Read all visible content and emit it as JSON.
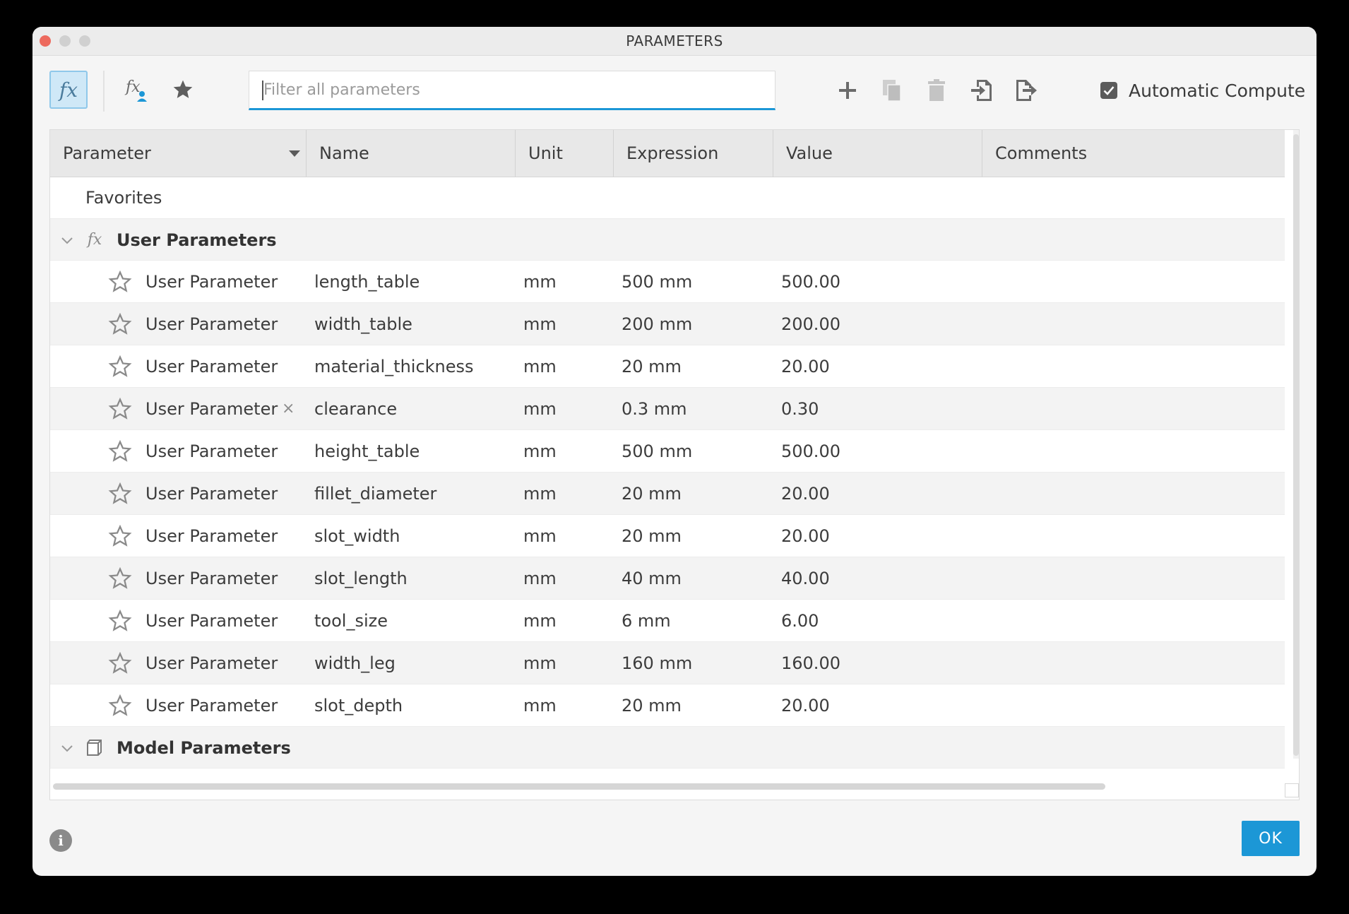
{
  "window": {
    "title": "PARAMETERS"
  },
  "toolbar": {
    "fx_label": "fx",
    "fx_user_label": "fx",
    "filter_placeholder": "Filter all parameters",
    "auto_compute_label": "Automatic Compute",
    "auto_compute_checked": true
  },
  "table": {
    "columns": [
      "Parameter",
      "Name",
      "Unit",
      "Expression",
      "Value",
      "Comments"
    ],
    "favorites_label": "Favorites",
    "user_group": {
      "label": "User Parameters",
      "icon": "fx"
    },
    "rows": [
      {
        "param": "User Parameter",
        "name": "length_table",
        "unit": "mm",
        "expr": "500 mm",
        "value": "500.00",
        "comment": ""
      },
      {
        "param": "User Parameter",
        "name": "width_table",
        "unit": "mm",
        "expr": "200 mm",
        "value": "200.00",
        "comment": ""
      },
      {
        "param": "User Parameter",
        "name": "material_thickness",
        "unit": "mm",
        "expr": "20 mm",
        "value": "20.00",
        "comment": ""
      },
      {
        "param": "User Parameter",
        "name": "clearance",
        "unit": "mm",
        "expr": "0.3 mm",
        "value": "0.30",
        "comment": "",
        "delete_mark": "×"
      },
      {
        "param": "User Parameter",
        "name": "height_table",
        "unit": "mm",
        "expr": "500 mm",
        "value": "500.00",
        "comment": ""
      },
      {
        "param": "User Parameter",
        "name": "fillet_diameter",
        "unit": "mm",
        "expr": "20 mm",
        "value": "20.00",
        "comment": ""
      },
      {
        "param": "User Parameter",
        "name": "slot_width",
        "unit": "mm",
        "expr": "20 mm",
        "value": "20.00",
        "comment": ""
      },
      {
        "param": "User Parameter",
        "name": "slot_length",
        "unit": "mm",
        "expr": "40 mm",
        "value": "40.00",
        "comment": ""
      },
      {
        "param": "User Parameter",
        "name": "tool_size",
        "unit": "mm",
        "expr": "6 mm",
        "value": "6.00",
        "comment": ""
      },
      {
        "param": "User Parameter",
        "name": "width_leg",
        "unit": "mm",
        "expr": "160 mm",
        "value": "160.00",
        "comment": ""
      },
      {
        "param": "User Parameter",
        "name": "slot_depth",
        "unit": "mm",
        "expr": "20 mm",
        "value": "20.00",
        "comment": ""
      }
    ],
    "model_group": {
      "label": "Model Parameters"
    }
  },
  "footer": {
    "info_glyph": "i",
    "ok_label": "OK"
  },
  "colors": {
    "accent": "#1c97d6",
    "close": "#ed6a5e"
  }
}
